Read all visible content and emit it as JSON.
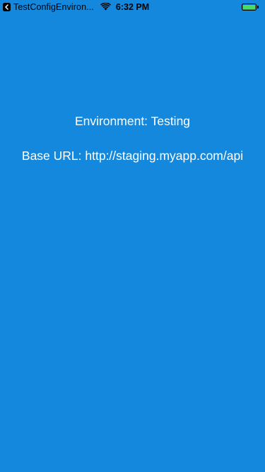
{
  "status_bar": {
    "back_app_label": "TestConfigEnviron...",
    "time": "6:32 PM",
    "battery_level": 1.0,
    "battery_color": "#4CD964"
  },
  "main": {
    "environment_text": "Environment: Testing",
    "base_url_text": "Base URL: http://staging.myapp.com/api"
  },
  "colors": {
    "background": "#1488DC",
    "text": "#FFFFFF"
  }
}
